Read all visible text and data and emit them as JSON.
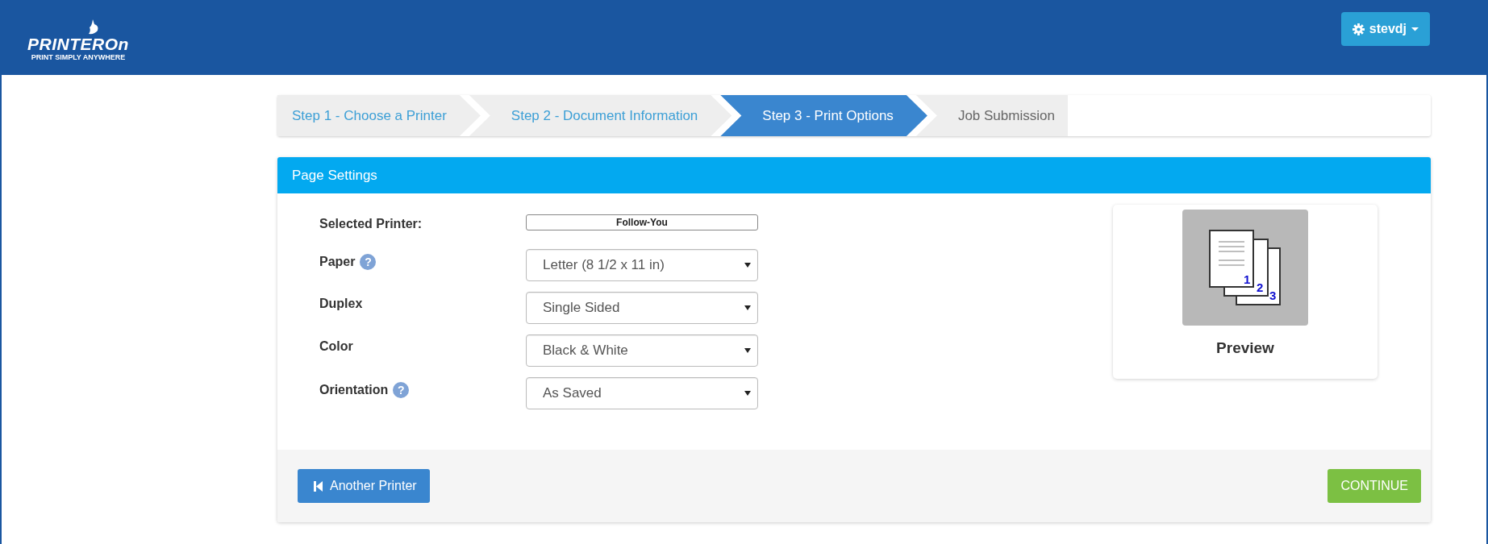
{
  "header": {
    "logo": {
      "name": "PRINTEROn",
      "tagline": "PRINT SIMPLY ANYWHERE"
    },
    "user_menu": {
      "label": "stevdj"
    }
  },
  "steps": [
    {
      "label": "Step 1 - Choose a Printer",
      "selected": false,
      "completed": true
    },
    {
      "label": "Step 2 - Document Information",
      "selected": false,
      "completed": true
    },
    {
      "label": "Step 3 - Print Options",
      "selected": true,
      "completed": false
    },
    {
      "label": "Job Submission",
      "selected": false,
      "completed": false
    }
  ],
  "panel": {
    "title": "Page Settings",
    "fields": [
      {
        "kind": "readonly",
        "label": "Selected Printer:",
        "value": "Follow-You"
      },
      {
        "kind": "select",
        "label": "Paper",
        "help": "?",
        "value": "Letter (8 1/2 x 11 in)"
      },
      {
        "kind": "select",
        "label": "Duplex",
        "value": "Single Sided"
      },
      {
        "kind": "select",
        "label": "Color",
        "value": "Black & White"
      },
      {
        "kind": "select",
        "label": "Orientation",
        "help": "?",
        "value": "As Saved"
      }
    ],
    "preview": {
      "label": "Preview",
      "page_numbers": [
        "1",
        "2",
        "3"
      ]
    },
    "buttons": [
      {
        "kind": "back",
        "label": "Another Printer"
      },
      {
        "kind": "continue",
        "label": "CONTINUE"
      }
    ]
  }
}
